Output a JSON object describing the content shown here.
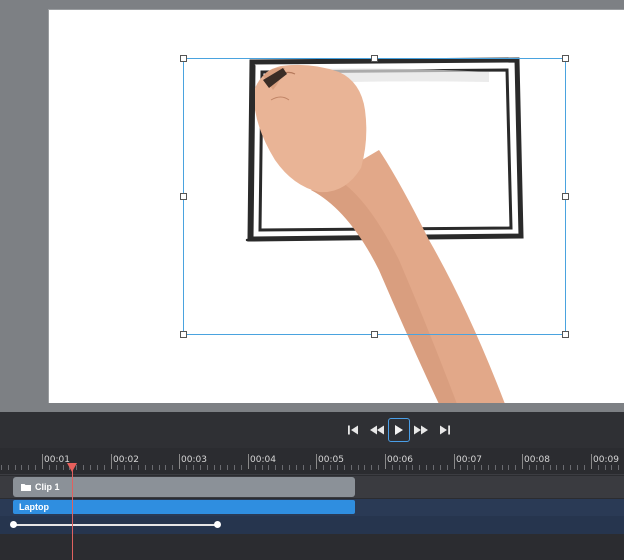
{
  "stage": {
    "layer_name": "Laptop"
  },
  "transport": {
    "skip_start": "⏮",
    "rewind": "⏪",
    "play": "▶",
    "fast_forward": "⏩",
    "skip_end": "⏭"
  },
  "ruler": {
    "labels": [
      "00:01",
      "00:02",
      "00:03",
      "00:04",
      "00:05",
      "00:06",
      "00:07",
      "00:08",
      "00:09"
    ]
  },
  "tracks": {
    "clip_label": "Clip 1",
    "clip_icon": "folder-icon",
    "layer_label": "Laptop"
  },
  "colors": {
    "accent": "#2f8ee0",
    "playhead": "#e0625f",
    "selection": "#4aa3df"
  }
}
